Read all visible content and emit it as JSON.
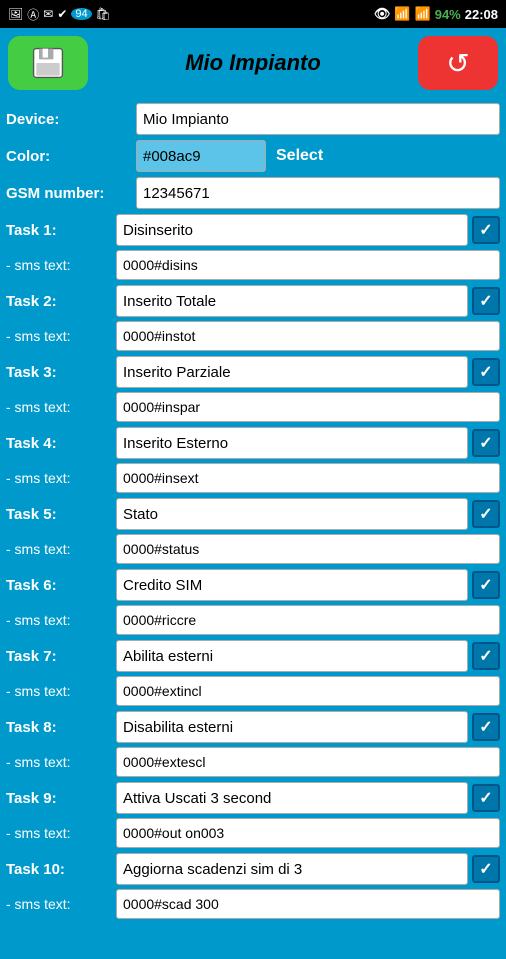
{
  "statusBar": {
    "icons": [
      "screenshot",
      "text",
      "email",
      "check",
      "94",
      "bag"
    ],
    "rightIcons": [
      "eye",
      "wifi",
      "signal",
      "battery"
    ],
    "battery": "94%",
    "time": "22:08"
  },
  "header": {
    "title": "Mio Impianto",
    "saveLabel": "💾",
    "backLabel": "↺"
  },
  "form": {
    "deviceLabel": "Device:",
    "deviceValue": "Mio Impianto",
    "colorLabel": "Color:",
    "colorValue": "#008ac9",
    "selectLabel": "Select",
    "gsmLabel": "GSM number:",
    "gsmValue": "12345671"
  },
  "tasks": [
    {
      "taskLabel": "Task 1:",
      "taskValue": "Disinserito",
      "smsLabel": "- sms text:",
      "smsValue": "0000#disins"
    },
    {
      "taskLabel": "Task 2:",
      "taskValue": "Inserito Totale",
      "smsLabel": "- sms text:",
      "smsValue": "0000#instot"
    },
    {
      "taskLabel": "Task 3:",
      "taskValue": "Inserito Parziale",
      "smsLabel": "- sms text:",
      "smsValue": "0000#inspar"
    },
    {
      "taskLabel": "Task 4:",
      "taskValue": "Inserito Esterno",
      "smsLabel": "- sms text:",
      "smsValue": "0000#insext"
    },
    {
      "taskLabel": "Task 5:",
      "taskValue": "Stato",
      "smsLabel": "- sms text:",
      "smsValue": "0000#status"
    },
    {
      "taskLabel": "Task 6:",
      "taskValue": "Credito SIM",
      "smsLabel": "- sms text:",
      "smsValue": "0000#riccre"
    },
    {
      "taskLabel": "Task 7:",
      "taskValue": "Abilita esterni",
      "smsLabel": "- sms text:",
      "smsValue": "0000#extincl"
    },
    {
      "taskLabel": "Task 8:",
      "taskValue": "Disabilita esterni",
      "smsLabel": "- sms text:",
      "smsValue": "0000#extescl"
    },
    {
      "taskLabel": "Task 9:",
      "taskValue": "Attiva Uscati 3 second",
      "smsLabel": "- sms text:",
      "smsValue": "0000#out on003"
    },
    {
      "taskLabel": "Task 10:",
      "taskValue": "Aggiorna scadenzi sim di 3",
      "smsLabel": "- sms text:",
      "smsValue": "0000#scad 300"
    }
  ]
}
